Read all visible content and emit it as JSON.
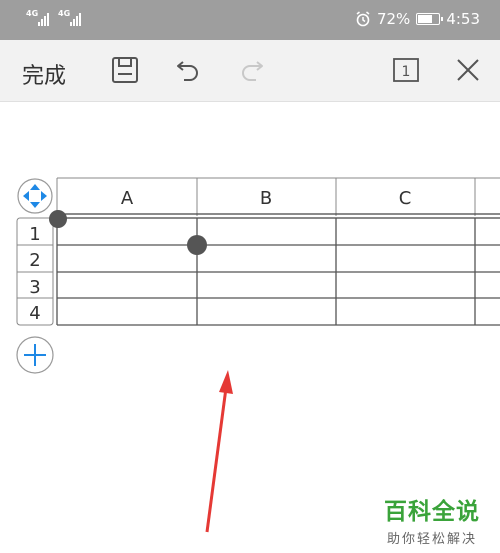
{
  "status_bar": {
    "signal_1": "4G",
    "signal_2": "4G",
    "battery": "72%",
    "time": "4:53",
    "battery_level": 0.72
  },
  "toolbar": {
    "done_label": "完成",
    "page_count": "1",
    "icons": [
      "save-icon",
      "undo-icon",
      "redo-icon",
      "page-icon",
      "close-icon"
    ]
  },
  "table": {
    "columns": [
      "A",
      "B",
      "C"
    ],
    "rows": [
      "1",
      "2",
      "3",
      "4"
    ]
  },
  "watermark": {
    "title": "百科全说",
    "subtitle": "助你轻松解决"
  },
  "colors": {
    "status_bar": "#9e9e9e",
    "toolbar": "#f2f2f2",
    "accent_blue": "#1e88e5",
    "annotation_arrow": "#e53935",
    "watermark_green": "#3aa33a"
  }
}
